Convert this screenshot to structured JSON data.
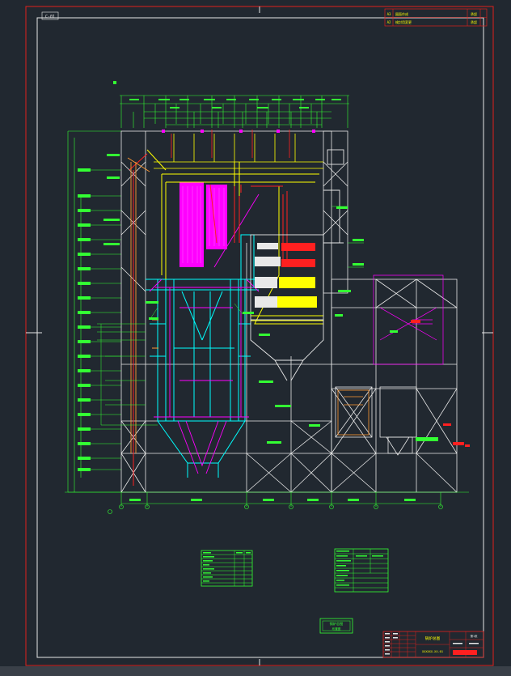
{
  "drawing": {
    "sheet_tag": "C-01",
    "revision_block": {
      "rows": [
        {
          "code": "A3",
          "text": "図面作成",
          "stamp": "承認"
        },
        {
          "code": "A2",
          "text": "検討用変更",
          "stamp": "承認"
        }
      ]
    },
    "center_title_label": "锅炉总图",
    "center_title_sub": "布置图",
    "title_block": {
      "title": "锅炉总图",
      "drawing_no": "XXXXXX-XX-01",
      "sheet": "第1张"
    }
  },
  "colors": {
    "background": "#212830",
    "frame_red": "#e0201c",
    "frame_white": "#e8e8e8",
    "structure": "#e8e8e8",
    "dimension": "#33ff33",
    "steel": "#00ffff",
    "pipe_magenta": "#ff00ff",
    "pipe_yellow": "#ffff00",
    "pipe_red": "#ff2020",
    "pipe_orange": "#ff9933"
  },
  "statusbar": {
    "text": ""
  }
}
